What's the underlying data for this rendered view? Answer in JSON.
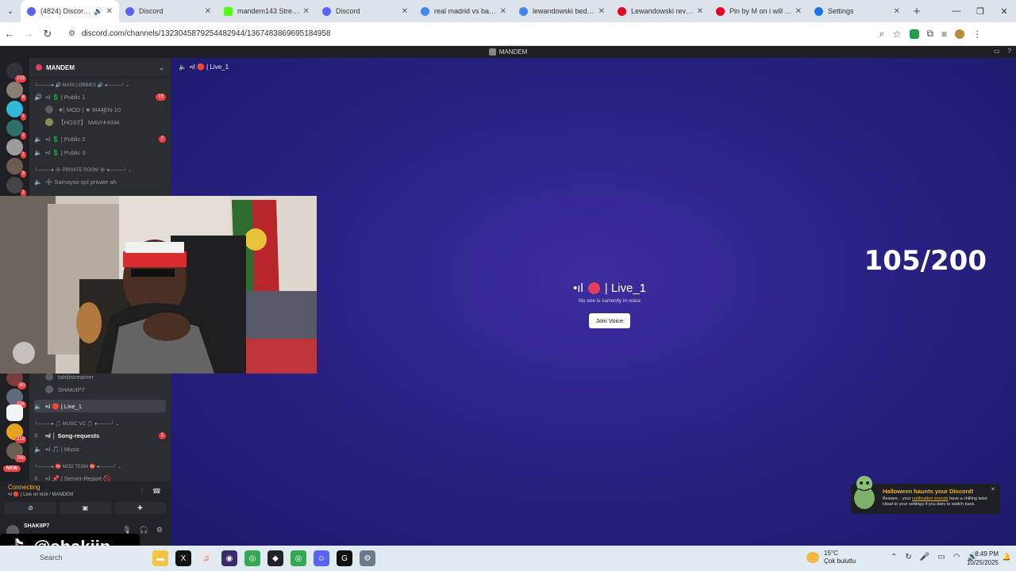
{
  "browser": {
    "tabs": [
      {
        "title": "(4824) Discord | · ",
        "favicon_color": "#5865f2",
        "active": true,
        "audio": true
      },
      {
        "title": "Discord",
        "favicon_color": "#5865f2"
      },
      {
        "title": "mandem143 Stream",
        "favicon_color": "#53fc18"
      },
      {
        "title": "Discord",
        "favicon_color": "#5865f2"
      },
      {
        "title": "real madrid vs barcel",
        "favicon_color": "#4285f4"
      },
      {
        "title": "lewandowski bed - G",
        "favicon_color": "#4285f4"
      },
      {
        "title": "Lewandowski revels",
        "favicon_color": "#e60023"
      },
      {
        "title": "Pin by M on i will wa",
        "favicon_color": "#e60023"
      },
      {
        "title": "Settings",
        "favicon_color": "#1a73e8"
      }
    ],
    "url": "discord.com/channels/1323045879254482944/1367483869695184958"
  },
  "discord": {
    "header_title": "MANDEM",
    "server_name": "MANDEM",
    "rail_badges": [
      "215",
      "8",
      "1",
      "2",
      "1",
      "3",
      "1",
      "60",
      "234",
      "319",
      "780"
    ],
    "new_label": "NEW",
    "channels_top": [
      {
        "type": "cat",
        "label": "└────● 🔊 MAIN LOBBIES 🔊 ●────┘ ⌄"
      },
      {
        "type": "voice",
        "label": "•ıl 💲 | Public 1",
        "badge": "16"
      },
      {
        "type": "member",
        "label": "★| MOD | ★ M44̲EN-10"
      },
      {
        "type": "member",
        "label": "【HOST】 MAVI✈KM4"
      },
      {
        "type": "voice",
        "label": "•ıl 💲 | Public 2",
        "badge": "7"
      },
      {
        "type": "voice",
        "label": "•ıl 💲 | Public 3"
      },
      {
        "type": "cat",
        "label": "└────● ➕ PRIVATE ROOM ➕ ●────┘ ⌄"
      },
      {
        "type": "voice",
        "label": "➕ Samayso qol private ah"
      }
    ],
    "channels_bottom": [
      {
        "type": "member",
        "label": "tahlilstreamer"
      },
      {
        "type": "member",
        "label": "SHAKIIP7"
      },
      {
        "type": "selected",
        "label": "•ıl 🔴 | Live_1"
      },
      {
        "type": "cat",
        "label": "└────● 🎵 MUSIC VC 🎵 ●────┘ ⌄"
      },
      {
        "type": "text-bold",
        "label": "•ıl │ Song-requests",
        "badge": "1"
      },
      {
        "type": "voice",
        "label": "•ıl 🎵 | Music"
      },
      {
        "type": "cat",
        "label": "└────● ⛔ MOD TEAM ⛔ ●────┘ ⌄"
      },
      {
        "type": "text",
        "label": "•ıl 📌 | Server-Report 🚫"
      }
    ],
    "voice_panel": {
      "status": "Connecting",
      "sub": "•ıl 🔴 | Live on kick / MANDEM"
    },
    "user_name": "SHAKIIP7",
    "stage_top_label": "•ıl 🔴 | Live_1",
    "stage_title": "| Live_1",
    "stage_title_prefix": "•ıl",
    "stage_sub": "No one is currently in voice",
    "join_label": "Join Voice",
    "counter": "105/200",
    "toast": {
      "title": "Halloween haunts your Discord!",
      "body_a": "Beware... your ",
      "body_link": "notification sounds",
      "body_b": " have a chilling twist. Head to your settings if you dare to switch back."
    }
  },
  "overlay": {
    "tiktok_handle": "@shakiip_"
  },
  "taskbar": {
    "search": "Search",
    "weather_temp": "15°C",
    "weather_desc": "Çok bulutlu",
    "time": "8:49 PM",
    "date": "10/25/2025"
  }
}
